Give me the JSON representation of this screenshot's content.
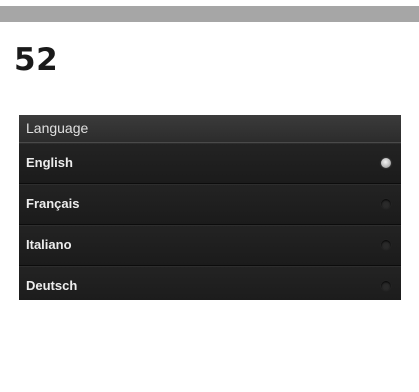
{
  "page_number": "52",
  "panel": {
    "title": "Language",
    "options": [
      {
        "label": "English",
        "selected": true
      },
      {
        "label": "Français",
        "selected": false
      },
      {
        "label": "Italiano",
        "selected": false
      },
      {
        "label": "Deutsch",
        "selected": false
      }
    ]
  },
  "colors": {
    "top_bar": "#a6a6a6",
    "panel_background": "#1c1c1c",
    "text": "#ededed"
  }
}
